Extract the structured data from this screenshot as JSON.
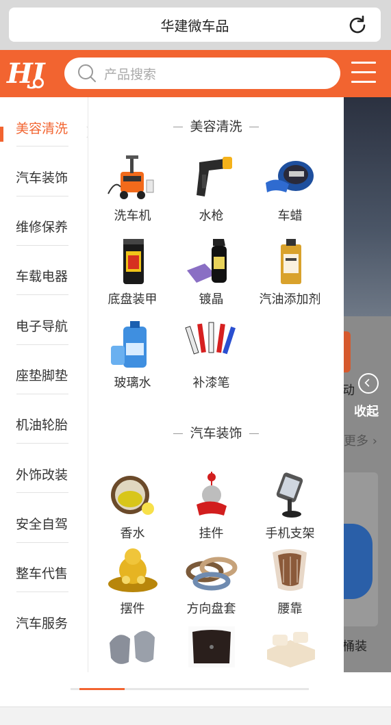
{
  "browser": {
    "url_title": "华建微车品"
  },
  "header": {
    "logo_text": "HJ",
    "search_placeholder": "产品搜索",
    "brand_color": "#f26430"
  },
  "background": {
    "side_text_1": "动",
    "collapse_label": "收起",
    "more_text": "更多 ›",
    "side_text_2": "桶装"
  },
  "categories": [
    {
      "label": "美容清洗",
      "active": true
    },
    {
      "label": "汽车装饰"
    },
    {
      "label": "维修保养"
    },
    {
      "label": "车载电器"
    },
    {
      "label": "电子导航"
    },
    {
      "label": "座垫脚垫"
    },
    {
      "label": "机油轮胎"
    },
    {
      "label": "外饰改装"
    },
    {
      "label": "安全自驾"
    },
    {
      "label": "整车代售"
    },
    {
      "label": "汽车服务"
    }
  ],
  "sections": [
    {
      "title": "美容清洗",
      "products": [
        {
          "label": "洗车机",
          "icon": "pressure-washer-icon"
        },
        {
          "label": "水枪",
          "icon": "water-gun-icon"
        },
        {
          "label": "车蜡",
          "icon": "car-wax-icon"
        },
        {
          "label": "底盘装甲",
          "icon": "underbody-coating-icon"
        },
        {
          "label": "镀晶",
          "icon": "ceramic-coating-icon"
        },
        {
          "label": "汽油添加剂",
          "icon": "fuel-additive-icon"
        },
        {
          "label": "玻璃水",
          "icon": "washer-fluid-icon"
        },
        {
          "label": "补漆笔",
          "icon": "touch-up-pen-icon"
        }
      ]
    },
    {
      "title": "汽车装饰",
      "products": [
        {
          "label": "香水",
          "icon": "car-perfume-icon"
        },
        {
          "label": "挂件",
          "icon": "hanging-ornament-icon"
        },
        {
          "label": "手机支架",
          "icon": "phone-holder-icon"
        },
        {
          "label": "摆件",
          "icon": "dashboard-figurine-icon"
        },
        {
          "label": "方向盘套",
          "icon": "steering-wheel-cover-icon"
        },
        {
          "label": "腰靠",
          "icon": "lumbar-cushion-icon"
        },
        {
          "label": "",
          "icon": "neck-pillow-icon"
        },
        {
          "label": "",
          "icon": "trunk-mat-icon"
        },
        {
          "label": "",
          "icon": "air-bed-icon"
        }
      ]
    }
  ]
}
